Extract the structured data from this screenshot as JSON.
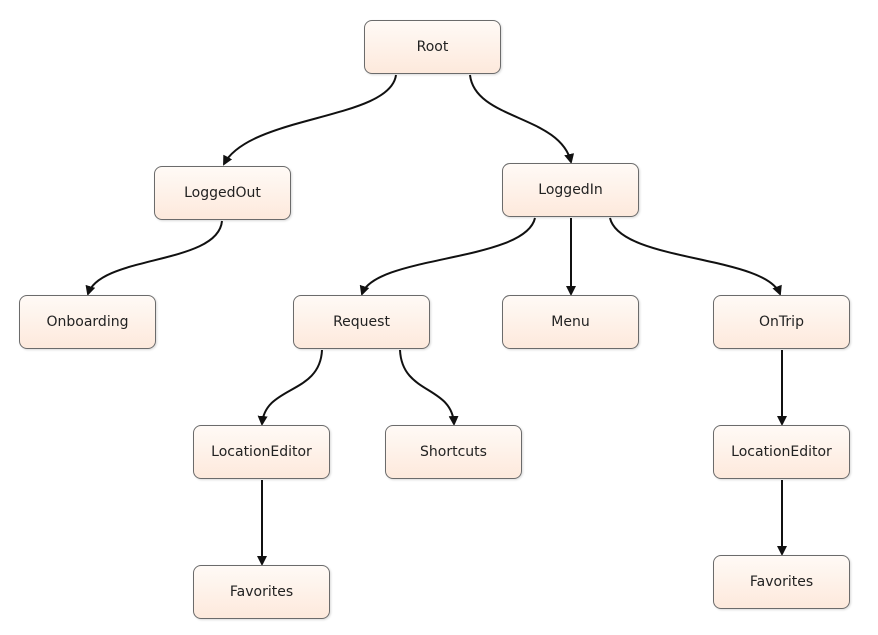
{
  "nodes": {
    "root": "Root",
    "logged_out": "LoggedOut",
    "logged_in": "LoggedIn",
    "onboarding": "Onboarding",
    "request": "Request",
    "menu": "Menu",
    "on_trip": "OnTrip",
    "location_editor_request": "LocationEditor",
    "shortcuts": "Shortcuts",
    "location_editor_trip": "LocationEditor",
    "favorites_request": "Favorites",
    "favorites_trip": "Favorites"
  },
  "edges": [
    [
      "root",
      "logged_out"
    ],
    [
      "root",
      "logged_in"
    ],
    [
      "logged_out",
      "onboarding"
    ],
    [
      "logged_in",
      "request"
    ],
    [
      "logged_in",
      "menu"
    ],
    [
      "logged_in",
      "on_trip"
    ],
    [
      "request",
      "location_editor_request"
    ],
    [
      "request",
      "shortcuts"
    ],
    [
      "location_editor_request",
      "favorites_request"
    ],
    [
      "on_trip",
      "location_editor_trip"
    ],
    [
      "location_editor_trip",
      "favorites_trip"
    ]
  ],
  "colors": {
    "node_fill_top": "#fffaf6",
    "node_fill_bottom": "#fde9dc",
    "node_border": "#6b6b6b",
    "edge": "#111111"
  }
}
